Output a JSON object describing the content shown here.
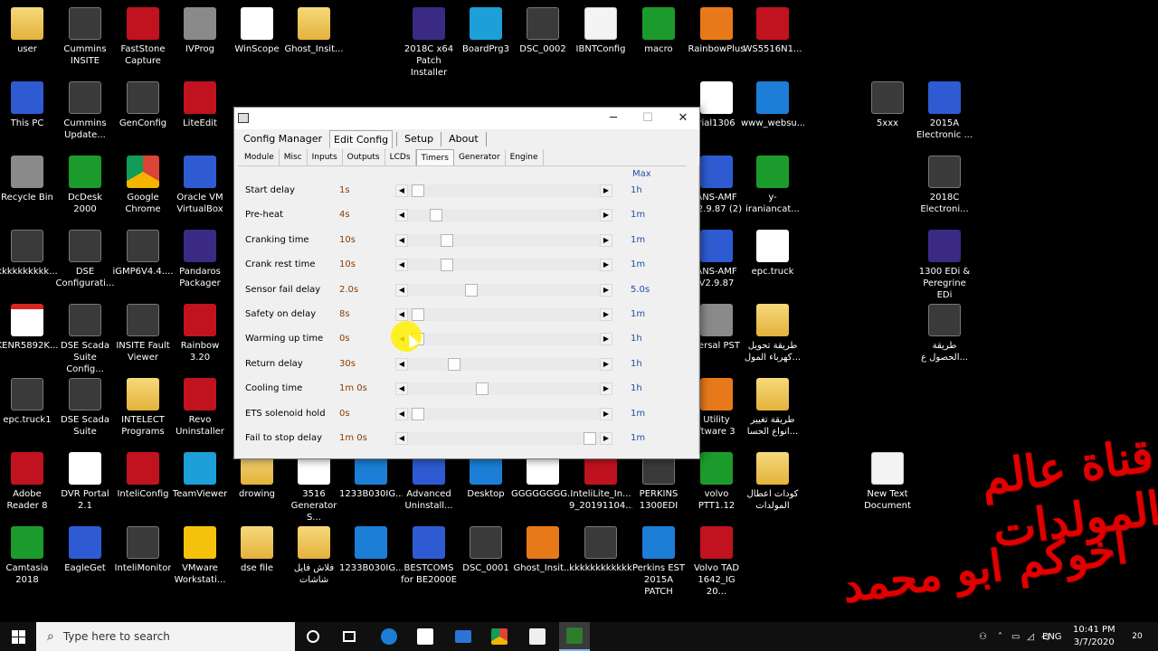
{
  "desktop": {
    "icons": [
      {
        "label": "user",
        "type": "folder"
      },
      {
        "label": "Cummins\nINSITE",
        "type": "app"
      },
      {
        "label": "FastStone\nCapture",
        "type": "red"
      },
      {
        "label": "IVProg",
        "type": "grey"
      },
      {
        "label": "WinScope",
        "type": "white"
      },
      {
        "label": "Ghost_Insit...",
        "type": "folder"
      },
      {
        "label": "2018C x64\nPatch Installer",
        "type": "purple"
      },
      {
        "label": "BoardPrg3",
        "type": "teal"
      },
      {
        "label": "DSC_0002",
        "type": "app"
      },
      {
        "label": "IBNTConfig",
        "type": "doc"
      },
      {
        "label": "macro",
        "type": "green"
      },
      {
        "label": "RainbowPlus",
        "type": "orange"
      },
      {
        "label": "WS5516N1...",
        "type": "red"
      },
      {
        "label": "This PC",
        "type": "blue"
      },
      {
        "label": "Cummins\nUpdate...",
        "type": "app"
      },
      {
        "label": "GenConfig",
        "type": "app"
      },
      {
        "label": "LiteEdit",
        "type": "red"
      },
      {
        "label": "rial1306",
        "type": "white"
      },
      {
        "label": "www_websu...",
        "type": "ie"
      },
      {
        "label": "5xxx",
        "type": "app"
      },
      {
        "label": "2015A\nElectronic ...",
        "type": "blue"
      },
      {
        "label": "Recycle Bin",
        "type": "grey"
      },
      {
        "label": "DcDesk 2000",
        "type": "green"
      },
      {
        "label": "Google\nChrome",
        "type": "chrome"
      },
      {
        "label": "Oracle VM\nVirtualBox",
        "type": "blue"
      },
      {
        "label": "ANS-AMF\nV2.9.87 (2)",
        "type": "blue"
      },
      {
        "label": "y-iraniancat...",
        "type": "green"
      },
      {
        "label": "2018C\nElectroni...",
        "type": "app"
      },
      {
        "label": "kkkkkkkkkk...",
        "type": "app"
      },
      {
        "label": "DSE\nConfigurati...",
        "type": "app"
      },
      {
        "label": "iGMP6V4.4....",
        "type": "app"
      },
      {
        "label": "Pandaros\nPackager",
        "type": "purple"
      },
      {
        "label": "ANS-AMF\nV2.9.87",
        "type": "blue"
      },
      {
        "label": "epc.truck",
        "type": "white"
      },
      {
        "label": "1300 EDi &\nPeregrine EDi",
        "type": "purple"
      },
      {
        "label": "KENR5892K...",
        "type": "pdf"
      },
      {
        "label": "DSE Scada\nSuite Config...",
        "type": "app"
      },
      {
        "label": "INSITE Fault\nViewer",
        "type": "app"
      },
      {
        "label": "Rainbow 3.20",
        "type": "red"
      },
      {
        "label": "versal PST",
        "type": "grey"
      },
      {
        "label": "طريقة تحويل\nكهرباء المول...",
        "type": "folder"
      },
      {
        "label": "طريقة\nالحصول ع...",
        "type": "app"
      },
      {
        "label": "epc.truck1",
        "type": "app"
      },
      {
        "label": "DSE Scada\nSuite",
        "type": "app"
      },
      {
        "label": "INTELECT\nPrograms",
        "type": "folder"
      },
      {
        "label": "Revo\nUninstaller",
        "type": "red"
      },
      {
        "label": "Utility\nftware 3",
        "type": "orange"
      },
      {
        "label": "طريقة تغيير\nانواع الحسا...",
        "type": "folder"
      },
      {
        "label": "Adobe\nReader 8",
        "type": "red"
      },
      {
        "label": "DVR Portal\n2.1",
        "type": "white"
      },
      {
        "label": "InteliConfig",
        "type": "red"
      },
      {
        "label": "TeamViewer",
        "type": "teal"
      },
      {
        "label": "drowing",
        "type": "folder"
      },
      {
        "label": "3516\nGenerator S...",
        "type": "pdf"
      },
      {
        "label": "1233B030IG...",
        "type": "ie"
      },
      {
        "label": "Advanced\nUninstall...",
        "type": "blue"
      },
      {
        "label": "Desktop",
        "type": "ie"
      },
      {
        "label": "GGGGGGGG...",
        "type": "pdf"
      },
      {
        "label": "InteliLite_In...\n9_20191104...",
        "type": "red"
      },
      {
        "label": "PERKINS\n1300EDI",
        "type": "app"
      },
      {
        "label": "volvo PTT1.12",
        "type": "green"
      },
      {
        "label": "كودات اعطال\nالمولدات",
        "type": "folder"
      },
      {
        "label": "New Text\nDocument",
        "type": "doc"
      },
      {
        "label": "Camtasia\n2018",
        "type": "green"
      },
      {
        "label": "EagleGet",
        "type": "blue"
      },
      {
        "label": "InteliMonitor",
        "type": "app"
      },
      {
        "label": "VMware\nWorkstati...",
        "type": "yellow"
      },
      {
        "label": "dse file",
        "type": "folder"
      },
      {
        "label": "فلاش فايل\nشاشات",
        "type": "folder"
      },
      {
        "label": "1233B030IG...",
        "type": "ie"
      },
      {
        "label": "BESTCOMS\nfor BE2000E",
        "type": "blue"
      },
      {
        "label": "DSC_0001",
        "type": "app"
      },
      {
        "label": "Ghost_Insit...",
        "type": "orange"
      },
      {
        "label": "kkkkkkkkkkkk",
        "type": "app"
      },
      {
        "label": "Perkins EST\n2015A PATCH",
        "type": "ie"
      },
      {
        "label": "Volvo TAD\n1642_IG 20...",
        "type": "red"
      }
    ]
  },
  "window": {
    "main_tabs": [
      "Config Manager",
      "Edit Config",
      "Setup",
      "About"
    ],
    "active_main": "Edit Config",
    "sub_tabs": [
      "Module",
      "Misc",
      "Inputs",
      "Outputs",
      "LCDs",
      "Timers",
      "Generator",
      "Engine"
    ],
    "active_sub": "Timers",
    "max_header": "Max",
    "timers": [
      {
        "label": "Start delay",
        "value": "1s",
        "max": "1h",
        "fraction": 0.02
      },
      {
        "label": "Pre-heat",
        "value": "4s",
        "max": "1m",
        "fraction": 0.12
      },
      {
        "label": "Cranking time",
        "value": "10s",
        "max": "1m",
        "fraction": 0.18
      },
      {
        "label": "Crank rest time",
        "value": "10s",
        "max": "1m",
        "fraction": 0.18
      },
      {
        "label": "Sensor fail delay",
        "value": "2.0s",
        "max": "5.0s",
        "fraction": 0.32
      },
      {
        "label": "Safety on delay",
        "value": "8s",
        "max": "1m",
        "fraction": 0.02
      },
      {
        "label": "Warming up time",
        "value": "0s",
        "max": "1h",
        "fraction": 0.02
      },
      {
        "label": "Return delay",
        "value": "30s",
        "max": "1h",
        "fraction": 0.22
      },
      {
        "label": "Cooling time",
        "value": "1m  0s",
        "max": "1h",
        "fraction": 0.38
      },
      {
        "label": "ETS solenoid hold",
        "value": "0s",
        "max": "1m",
        "fraction": 0.02
      },
      {
        "label": "Fail to stop delay",
        "value": "1m  0s",
        "max": "1m",
        "fraction": 0.98
      }
    ],
    "controls": {
      "minimize": "─",
      "maximize": "☐",
      "close": "✕",
      "left_arrow": "◀",
      "right_arrow": "▶"
    }
  },
  "watermark": {
    "line1": "قناة عالم المولدات",
    "line2": "اخوكم ابو محمد"
  },
  "taskbar": {
    "search_placeholder": "Type here to search",
    "search_icon": "⌕",
    "language": "ENG",
    "time": "10:41 PM",
    "date": "3/7/2020",
    "notification_count": "20"
  }
}
